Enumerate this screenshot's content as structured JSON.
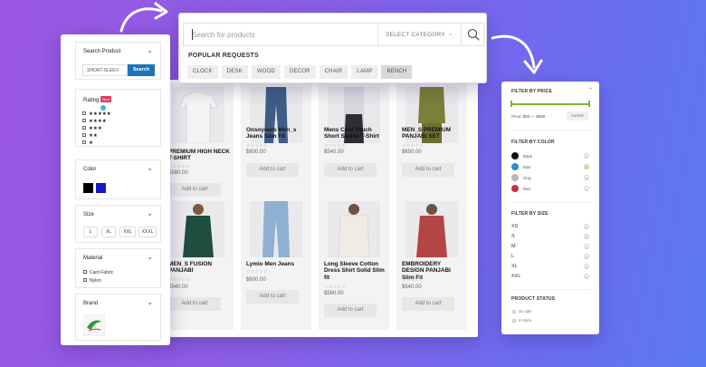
{
  "search": {
    "placeholder": "Search for products",
    "category": "SELECT CATEGORY",
    "popular_heading": "POPULAR REQUESTS",
    "tags": [
      "CLOCK",
      "DESK",
      "WOOD",
      "DECOR",
      "CHAIR",
      "LAMP",
      "BENCH"
    ]
  },
  "products": [
    {
      "title": "PREMIUM HIGH NECK T-SHIRT",
      "price": "$580.00",
      "add": "Add to cart"
    },
    {
      "title": "Onsoyours Men_s Jeans Slim Fit",
      "price": "$600.00",
      "add": "Add to cart"
    },
    {
      "title": "Mens Cool Touch Short Sleeve T-Shirt",
      "price": "$540.00",
      "add": "Add to cart"
    },
    {
      "title": "MEN_S PREMIUM PANJABI SET",
      "price": "$650.00",
      "add": "Add to cart"
    },
    {
      "title": "MEN_S FUSION PANJABI",
      "price": "$540.00",
      "add": "Add to cart"
    },
    {
      "title": "Lymio Men Jeans",
      "price": "$600.00",
      "add": "Add to cart"
    },
    {
      "title": "Long Sleeve Cotton Dress Shirt Solid Slim fit",
      "price": "$580.00",
      "add": "Add to cart"
    },
    {
      "title": "EMBROIDERY DESIGN PANJABI Slim Fit",
      "price": "$540.00",
      "add": "Add to cart"
    }
  ],
  "left_filters": {
    "search_product": {
      "heading": "Search Product",
      "value": "SHORT-SLEEV",
      "button": "Search"
    },
    "rating": {
      "heading": "Rating",
      "badge": "New",
      "rows": [
        "★★★★★",
        "★★★★",
        "★★★",
        "★★",
        "★"
      ]
    },
    "color": {
      "heading": "Color",
      "swatches": [
        "#000000",
        "#1616c8"
      ]
    },
    "size": {
      "heading": "Size",
      "options": [
        "L",
        "XL",
        "XXL",
        "XXXL"
      ]
    },
    "material": {
      "heading": "Material",
      "options": [
        "Card Fabric",
        "Nylon"
      ]
    },
    "brand": {
      "heading": "Brand"
    }
  },
  "right_filters": {
    "price": {
      "heading": "FILTER BY PRICE",
      "range": "Price: $60 — $680",
      "button": "FILTER"
    },
    "color": {
      "heading": "FILTER BY COLOR",
      "options": [
        {
          "name": "Black",
          "count": "1",
          "color": "#111111"
        },
        {
          "name": "Blue",
          "count": "1",
          "color": "#2a8ed6"
        },
        {
          "name": "Gray",
          "count": "4",
          "color": "#b8b8b8"
        },
        {
          "name": "Red",
          "count": "1",
          "color": "#c62f3a"
        }
      ]
    },
    "size": {
      "heading": "FILTER BY SIZE",
      "options": [
        {
          "name": "XS",
          "count": "2"
        },
        {
          "name": "S",
          "count": "3"
        },
        {
          "name": "M",
          "count": "1"
        },
        {
          "name": "L",
          "count": "3"
        },
        {
          "name": "XL",
          "count": "3"
        },
        {
          "name": "XXL",
          "count": "1"
        }
      ]
    },
    "status": {
      "heading": "PRODUCT STATUS",
      "options": [
        "On sale",
        "In stock"
      ]
    }
  },
  "colors": {
    "accent": "#1c74b8",
    "price_slider": "#76b836",
    "background_start": "#9b57e0",
    "background_end": "#5b78f2"
  }
}
